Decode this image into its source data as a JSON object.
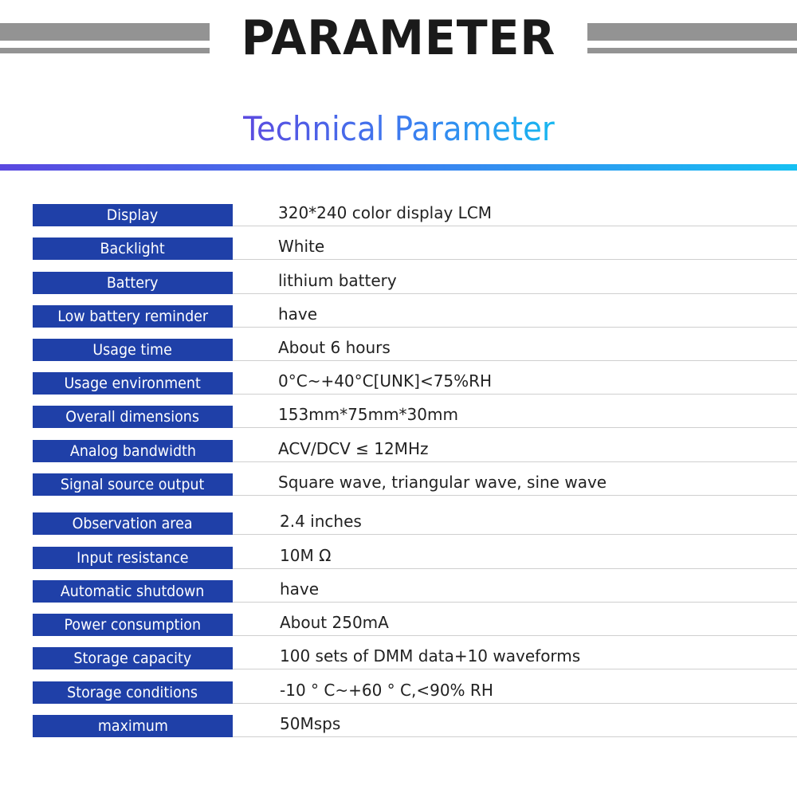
{
  "header": {
    "title": "PARAMETER",
    "subtitle": "Technical Parameter"
  },
  "colors": {
    "label_background": "#1f40a8",
    "label_text": "#ffffff",
    "value_text": "#222222",
    "header_bars": "#939393",
    "gradient_start": "#5a48e0",
    "gradient_end": "#16c0f2",
    "row_divider": "#cfcfcf"
  },
  "parameters": [
    {
      "label": "Display",
      "value": "320*240 color display LCM"
    },
    {
      "label": "Backlight",
      "value": "White"
    },
    {
      "label": "Battery",
      "value": "lithium battery"
    },
    {
      "label": "Low battery reminder",
      "value": "have"
    },
    {
      "label": "Usage time",
      "value": "About 6 hours"
    },
    {
      "label": "Usage environment",
      "value": "0°C~+40°C[UNK]<75%RH"
    },
    {
      "label": "Overall dimensions",
      "value": "153mm*75mm*30mm"
    },
    {
      "label": "Analog bandwidth",
      "value": "ACV/DCV ≤ 12MHz"
    },
    {
      "label": "Signal source output",
      "value": "Square wave, triangular wave, sine wave"
    },
    {
      "label": "Observation area",
      "value": "2.4 inches"
    },
    {
      "label": "Input resistance",
      "value": "10M Ω"
    },
    {
      "label": "Automatic shutdown",
      "value": "have"
    },
    {
      "label": "Power consumption",
      "value": "About 250mA"
    },
    {
      "label": "Storage capacity",
      "value": "100 sets of DMM data+10 waveforms"
    },
    {
      "label": "Storage conditions",
      "value": "-10 ° C~+60 ° C,<90% RH"
    },
    {
      "label": "maximum",
      "value": "50Msps"
    }
  ]
}
